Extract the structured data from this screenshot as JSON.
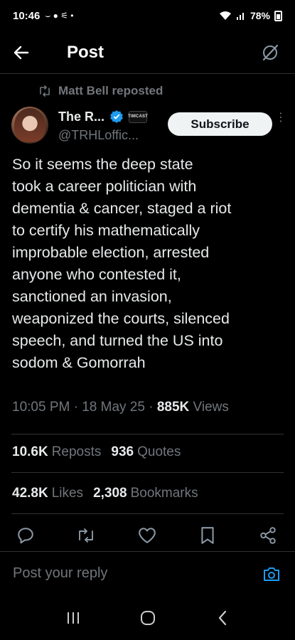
{
  "status_bar": {
    "time": "10:46",
    "battery": "78%"
  },
  "header": {
    "title": "Post"
  },
  "repost": {
    "text": "Matt Bell reposted"
  },
  "author": {
    "display_name": "The R...",
    "handle": "@TRHLoffic...",
    "affiliate_badge": "TIMCAST",
    "subscribe_label": "Subscribe"
  },
  "tweet": {
    "text": "So it seems the deep state\ntook a career politician with\ndementia & cancer, staged a riot\nto certify his mathematically\nimprobable election, arrested\nanyone who contested it,\nsanctioned an invasion,\nweaponized the courts, silenced\nspeech, and turned the US into\nsodom & Gomorrah",
    "time": "10:05 PM",
    "date": "18 May 25",
    "views_count": "885K",
    "views_label": "Views"
  },
  "stats": {
    "reposts_count": "10.6K",
    "reposts_label": "Reposts",
    "quotes_count": "936",
    "quotes_label": "Quotes",
    "likes_count": "42.8K",
    "likes_label": "Likes",
    "bookmarks_count": "2,308",
    "bookmarks_label": "Bookmarks"
  },
  "reply": {
    "placeholder": "Post your reply"
  },
  "colors": {
    "accent": "#1d9bf0",
    "muted": "#71767b",
    "text": "#e7e9ea",
    "background": "#000000"
  },
  "icons": [
    "back-arrow-icon",
    "grok-icon",
    "repost-icon",
    "verified-icon",
    "more-icon",
    "reply-icon",
    "retweet-icon",
    "like-icon",
    "bookmark-icon",
    "share-icon",
    "camera-icon",
    "recents-icon",
    "home-icon",
    "back-icon"
  ]
}
